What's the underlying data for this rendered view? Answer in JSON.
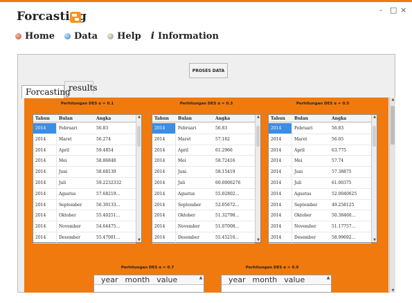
{
  "window": {
    "title": "Forcasting",
    "controls": {
      "minimize": "-",
      "maximize": "□",
      "close": "×"
    }
  },
  "menu": {
    "home": "Home",
    "data": "Data",
    "help": "Help",
    "information": "Information",
    "information_glyph": "i"
  },
  "toolbar": {
    "proses_label": "PROSES DATA"
  },
  "tabs": [
    {
      "label": "Forcasting",
      "active": true
    },
    {
      "label": "results",
      "active": false
    }
  ],
  "tables": [
    {
      "title": "Perhitungan DES α = 0.1",
      "columns": [
        "Tahun",
        "Bulan",
        "Angka"
      ],
      "rows": [
        [
          "2014",
          "Februari",
          "56.83"
        ],
        [
          "2014",
          "Maret",
          "56.274"
        ],
        [
          "2014",
          "April",
          "59.4854"
        ],
        [
          "2014",
          "Mei",
          "58.86848"
        ],
        [
          "2014",
          "Juni",
          "58.68139"
        ],
        [
          "2014",
          "Juli",
          "59.2232332"
        ],
        [
          "2014",
          "Agustus",
          "57.68219..."
        ],
        [
          "2014",
          "September",
          "56.30133..."
        ],
        [
          "2014",
          "Oktober",
          "55.40251..."
        ],
        [
          "2014",
          "November",
          "54.64475..."
        ],
        [
          "2014",
          "Desember",
          "55.47081..."
        ]
      ]
    },
    {
      "title": "Perhitungan DES α = 0.3",
      "columns": [
        "Tahun",
        "Bulan",
        "Angka"
      ],
      "rows": [
        [
          "2014",
          "Februari",
          "56.83"
        ],
        [
          "2014",
          "Maret",
          "57.162"
        ],
        [
          "2014",
          "April",
          "61.2966"
        ],
        [
          "2014",
          "Mei",
          "58.72416"
        ],
        [
          "2014",
          "Juni",
          "58.15419"
        ],
        [
          "2014",
          "Juli",
          "60.0006276"
        ],
        [
          "2014",
          "Agustus",
          "55.02802..."
        ],
        [
          "2014",
          "September",
          "52.05672..."
        ],
        [
          "2014",
          "Oktober",
          "51.32798..."
        ],
        [
          "2014",
          "November",
          "51.07008..."
        ],
        [
          "2014",
          "Desember",
          "55.45210..."
        ]
      ]
    },
    {
      "title": "Perhitungan DES α = 0.5",
      "columns": [
        "Tahun",
        "Bulan",
        "Angka"
      ],
      "rows": [
        [
          "2014",
          "Februari",
          "56.83"
        ],
        [
          "2014",
          "Maret",
          "56.05"
        ],
        [
          "2014",
          "April",
          "63.775"
        ],
        [
          "2014",
          "Mei",
          "57.74"
        ],
        [
          "2014",
          "Juni",
          "57.38875"
        ],
        [
          "2014",
          "Juli",
          "61.00375"
        ],
        [
          "2014",
          "Agustus",
          "52.0040625"
        ],
        [
          "2014",
          "September",
          "49.258125"
        ],
        [
          "2014",
          "Oktober",
          "50.38460..."
        ],
        [
          "2014",
          "November",
          "51.17757..."
        ],
        [
          "2014",
          "Desember",
          "58.99692..."
        ]
      ]
    }
  ],
  "bottom": [
    {
      "title": "Perhitungan DES α = 0.7",
      "columns": [
        "year",
        "month",
        "value"
      ]
    },
    {
      "title": "Perhitungan DES α = 0.9",
      "columns": [
        "year",
        "month",
        "value"
      ]
    }
  ],
  "scroll": {
    "up": "▲",
    "down": "▼"
  }
}
